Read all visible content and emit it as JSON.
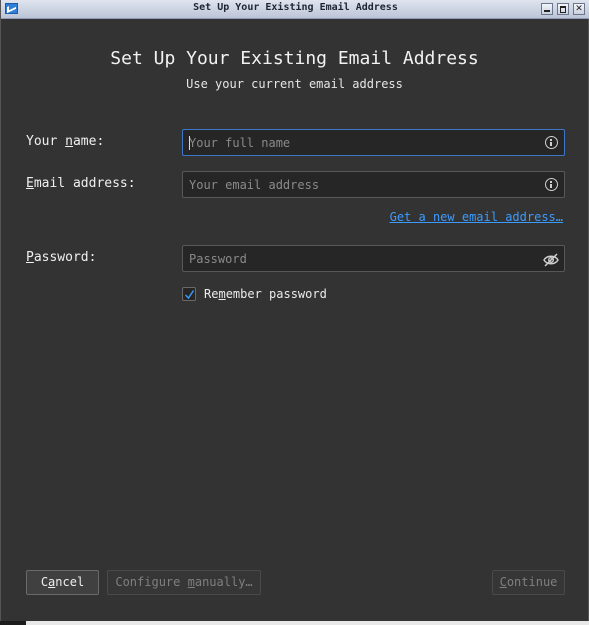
{
  "window": {
    "title": "Set Up Your Existing Email Address"
  },
  "header": {
    "title": "Set Up Your Existing Email Address",
    "subtitle": "Use your current email address"
  },
  "form": {
    "name": {
      "label_prefix": "Your ",
      "label_access": "n",
      "label_suffix": "ame:",
      "placeholder": "Your full name",
      "value": ""
    },
    "email": {
      "label_access": "E",
      "label_suffix": "mail address:",
      "placeholder": "Your email address",
      "value": ""
    },
    "new_email_link": {
      "access": "G",
      "rest": "et a new email address…"
    },
    "password": {
      "label_access": "P",
      "label_suffix": "assword:",
      "placeholder": "Password",
      "value": ""
    },
    "remember": {
      "prefix": "Re",
      "access": "m",
      "suffix": "ember password",
      "checked": true
    }
  },
  "buttons": {
    "cancel": {
      "prefix": "C",
      "access": "a",
      "suffix": "ncel"
    },
    "manual": {
      "prefix": "Configure ",
      "access": "m",
      "suffix": "anually…"
    },
    "continue": {
      "access": "C",
      "suffix": "ontinue"
    }
  },
  "colors": {
    "background": "#333333",
    "link": "#3d9bff",
    "focus_border": "#3c78c8"
  },
  "icons": {
    "name_field": "info-icon",
    "email_field": "info-icon",
    "password_field": "eye-slash-icon",
    "checkbox": "checkmark-icon"
  }
}
